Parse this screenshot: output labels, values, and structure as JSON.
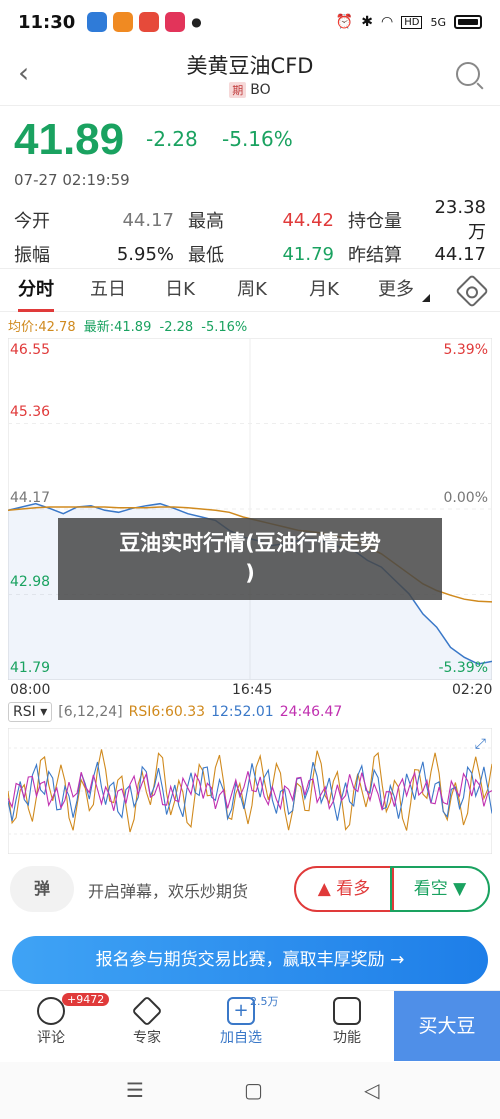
{
  "status_bar": {
    "time": "11:30",
    "apps": [
      {
        "icon": "app-blue-icon",
        "color": "#2f7bd8",
        "label": ""
      },
      {
        "icon": "app-orange-icon",
        "color": "#f08a22",
        "label": ""
      },
      {
        "icon": "app-red-icon",
        "color": "#e64a3a",
        "label": ""
      },
      {
        "icon": "app-pink-icon",
        "color": "#e2345a",
        "label": ""
      }
    ],
    "indicators": [
      "alarm-icon",
      "bluetooth-icon",
      "wifi-icon",
      "hd-icon",
      "signal-icon",
      "battery-icon"
    ],
    "hd_text": "HD",
    "net_text": "5G"
  },
  "header": {
    "title": "美黄豆油CFD",
    "badge": "期",
    "code": "BO"
  },
  "quote": {
    "price": "41.89",
    "change": "-2.28",
    "change_pct": "-5.16%",
    "timestamp": "07-27 02:19:59"
  },
  "stats": {
    "row1": [
      {
        "label": "今开",
        "value": "44.17",
        "color": "gray"
      },
      {
        "label": "最高",
        "value": "44.42",
        "color": "red"
      },
      {
        "label": "持仓量",
        "value": "23.38万",
        "color": "dark"
      }
    ],
    "row2": [
      {
        "label": "振幅",
        "value": "5.95%",
        "color": "dark"
      },
      {
        "label": "最低",
        "value": "41.79",
        "color": "green"
      },
      {
        "label": "昨结算",
        "value": "44.17",
        "color": "dark"
      }
    ]
  },
  "tabs": [
    "分时",
    "五日",
    "日K",
    "周K",
    "月K",
    "更多"
  ],
  "legend": {
    "avg": "均价:42.78",
    "latest": "最新:41.89",
    "change": "-2.28",
    "pct": "-5.16%"
  },
  "chart_data": {
    "type": "line",
    "y_ticks_left": [
      "46.55",
      "45.36",
      "44.17",
      "42.98",
      "41.79"
    ],
    "y_ticks_right": [
      "5.39%",
      "0.00%",
      "-5.39%"
    ],
    "x_ticks": [
      "08:00",
      "16:45",
      "02:20"
    ],
    "ylim": [
      41.79,
      46.55
    ],
    "series": [
      {
        "values": [
          44.15,
          44.2,
          44.25,
          44.18,
          44.1,
          44.2,
          44.22,
          44.15,
          44.12,
          44.18,
          44.22,
          44.25,
          44.18,
          44.1,
          44.05,
          44.0,
          43.85,
          43.75,
          43.7,
          43.62,
          43.65,
          43.7,
          43.72,
          43.68,
          43.6,
          43.55,
          43.4,
          43.3,
          43.1,
          42.9,
          42.6,
          42.4,
          42.1,
          41.95,
          41.85,
          41.89
        ]
      },
      {
        "values": [
          44.15,
          44.17,
          44.19,
          44.2,
          44.2,
          44.2,
          44.2,
          44.2,
          44.19,
          44.19,
          44.19,
          44.2,
          44.2,
          44.19,
          44.17,
          44.15,
          44.12,
          44.05,
          44.0,
          43.95,
          43.9,
          43.85,
          43.83,
          43.8,
          43.75,
          43.7,
          43.6,
          43.5,
          43.35,
          43.2,
          43.05,
          42.95,
          42.88,
          42.82,
          42.79,
          42.78
        ]
      }
    ]
  },
  "overlay": {
    "line1": "豆油实时行情(豆油行情走势",
    "line2": ")"
  },
  "rsi": {
    "select": "RSI",
    "params": "[6,12,24]",
    "rsi6": "RSI6:60.33",
    "rsi12": "12:52.01",
    "rsi24": "24:46.47"
  },
  "comment": {
    "danmu": "弹",
    "placeholder": "开启弹幕，欢乐炒期货",
    "bull": "看多",
    "bear": "看空"
  },
  "promo": {
    "text": "报名参与期货交易比赛，赢取丰厚奖励 →"
  },
  "bottom_nav": {
    "items": [
      "评论",
      "专家",
      "加自选",
      "功能"
    ],
    "comment_badge": "+9472",
    "fav_count": "2.5万",
    "buy": "买大豆"
  },
  "colors": {
    "green": "#1aa260",
    "red": "#e03a3a",
    "avg_line": "#d08a1e",
    "price_line": "#3a78c8"
  }
}
